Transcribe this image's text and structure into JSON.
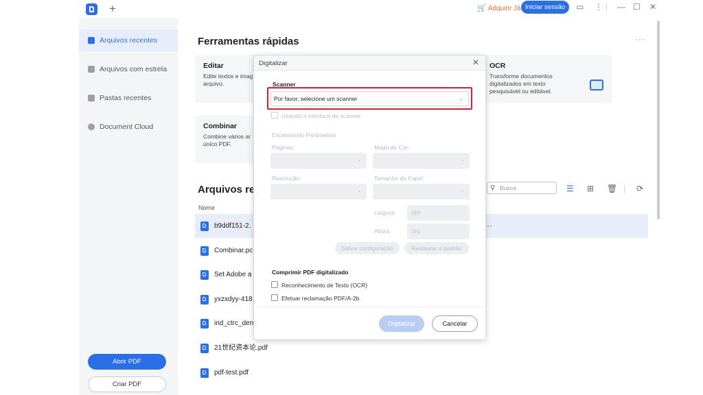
{
  "titlebar": {
    "buy_label": "Adquirir Já",
    "login_label": "Iniciar sessão",
    "icons": [
      "chat-icon",
      "more-icon",
      "minimize-icon",
      "maximize-icon",
      "close-icon"
    ]
  },
  "sidebar": {
    "items": [
      {
        "label": "Arquivos recentes",
        "icon": "recent-files-icon"
      },
      {
        "label": "Arquivos com estrela",
        "icon": "star-icon"
      },
      {
        "label": "Pastas recentes",
        "icon": "folder-icon"
      },
      {
        "label": "Document Cloud",
        "icon": "cloud-icon"
      }
    ],
    "open_pdf": "Abrir PDF",
    "create_pdf": "Criar PDF"
  },
  "main": {
    "tools_title": "Ferramentas rápidas",
    "tools": [
      {
        "title": "Editar",
        "desc": "Edite textos e imag arquivo."
      },
      {
        "title": "Combinar",
        "desc": "Combine vários ar único PDF."
      },
      {
        "title": "OCR",
        "desc": "Transforme documentos digitalizados em texto pesquisável ou editável."
      }
    ],
    "recent_title": "Arquivos rec",
    "column_name": "Nome",
    "search_placeholder": "Busca",
    "files": [
      "b9ddf151-2.",
      "Combinar.pc",
      "Set Adobe a",
      "yxzxdyy-418",
      "ind_ctrc_den",
      "21世纪资本论.pdf",
      "pdf-test.pdf"
    ],
    "row_more": "···"
  },
  "dialog": {
    "title": "Digitalizar",
    "scanner_label": "Scanner",
    "scanner_value": "Por favor, selecione um scanner",
    "use_interface": "Usando a interface do scanner",
    "params_label": "Escaneando Parâmetros",
    "pages_label": "Páginas:",
    "color_mode_label": "Modo de Cor:",
    "resolution_label": "Resolução:",
    "paper_size_label": "Tamanho do Papel:",
    "width_label": "Largura:",
    "height_label": "Altura:",
    "unit": "(in)",
    "save_config": "Salvar configuração",
    "restore_default": "Restaurar o padrão",
    "compress_label": "Comprimir PDF digitalizado",
    "ocr_option": "Reconhecimento de Texto (OCR)",
    "pdfa_option": "Efetuar reclamação PDF/A-2b",
    "scan_button": "Digitalizar",
    "cancel_button": "Cancelar"
  }
}
